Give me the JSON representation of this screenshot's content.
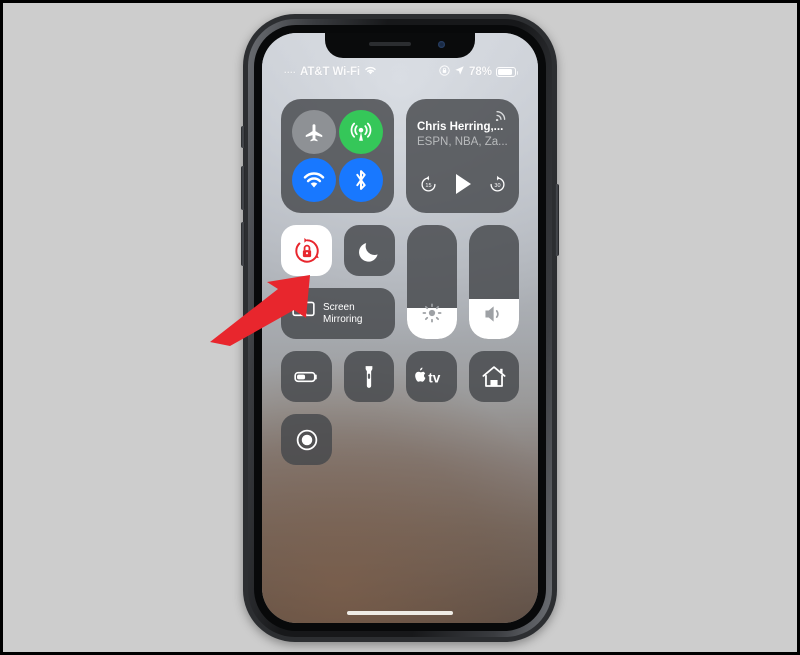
{
  "scene": {
    "description": "iPhone X screenshot showing iOS Control Center with a red annotation arrow pointing at the Portrait Orientation Lock button",
    "background_color": "#cdcdcd",
    "border_color": "#000000"
  },
  "device": {
    "name": "iphone-x",
    "frame_color": "#2c2e31",
    "buttons": {
      "mute_switch": "Mute Switch",
      "volume_up": "Volume Up",
      "volume_down": "Volume Down",
      "side_button": "Side Button"
    }
  },
  "status_bar": {
    "signal_dots": "....",
    "carrier": "AT&T Wi-Fi",
    "wifi_icon": "wifi-icon",
    "rotation_lock_icon": "rotation-lock-status-icon",
    "location_icon": "location-arrow-icon",
    "battery_percent": "78%",
    "battery_level": 78,
    "battery_icon": "battery-icon"
  },
  "control_center": {
    "connectivity": {
      "label": "Connectivity",
      "airplane_mode": {
        "label": "Airplane Mode",
        "icon": "airplane-icon",
        "active": false,
        "color": "#8e9195"
      },
      "cellular_data": {
        "label": "Cellular Data",
        "icon": "cellular-icon",
        "active": true,
        "color": "#35c759"
      },
      "wifi": {
        "label": "Wi-Fi",
        "icon": "wifi-icon",
        "active": true,
        "color": "#1878ff"
      },
      "bluetooth": {
        "label": "Bluetooth",
        "icon": "bluetooth-icon",
        "active": true,
        "color": "#1878ff"
      }
    },
    "now_playing": {
      "title": "Chris Herring,...",
      "subtitle": "ESPN, NBA, Za...",
      "airplay_icon": "airplay-audio-icon",
      "skip_back_label": "15",
      "skip_forward_label": "30",
      "play_icon": "play-icon",
      "state": "paused"
    },
    "rotation_lock": {
      "label": "Portrait Orientation Lock",
      "icon": "rotation-lock-icon",
      "active": true,
      "tile_color": "#ffffff",
      "icon_color": "#e8262d"
    },
    "do_not_disturb": {
      "label": "Do Not Disturb",
      "icon": "moon-icon",
      "active": false
    },
    "screen_mirroring": {
      "label_line1": "Screen",
      "label_line2": "Mirroring",
      "icon": "screen-mirroring-icon"
    },
    "brightness": {
      "label": "Brightness",
      "icon": "brightness-icon",
      "value": 27
    },
    "volume": {
      "label": "Volume",
      "icon": "speaker-icon",
      "value": 35
    },
    "low_power_mode": {
      "label": "Low Power Mode",
      "icon": "battery-icon"
    },
    "flashlight": {
      "label": "Flashlight",
      "icon": "flashlight-icon"
    },
    "apple_tv_remote": {
      "label": "Apple TV Remote",
      "icon": "apple-tv-icon"
    },
    "home": {
      "label": "Home",
      "icon": "home-icon"
    },
    "screen_recording": {
      "label": "Screen Recording",
      "icon": "screen-recording-icon"
    }
  },
  "annotation": {
    "arrow": {
      "name": "red-arrow-pointer",
      "color": "#e8262d",
      "points_to": "Portrait Orientation Lock"
    }
  }
}
